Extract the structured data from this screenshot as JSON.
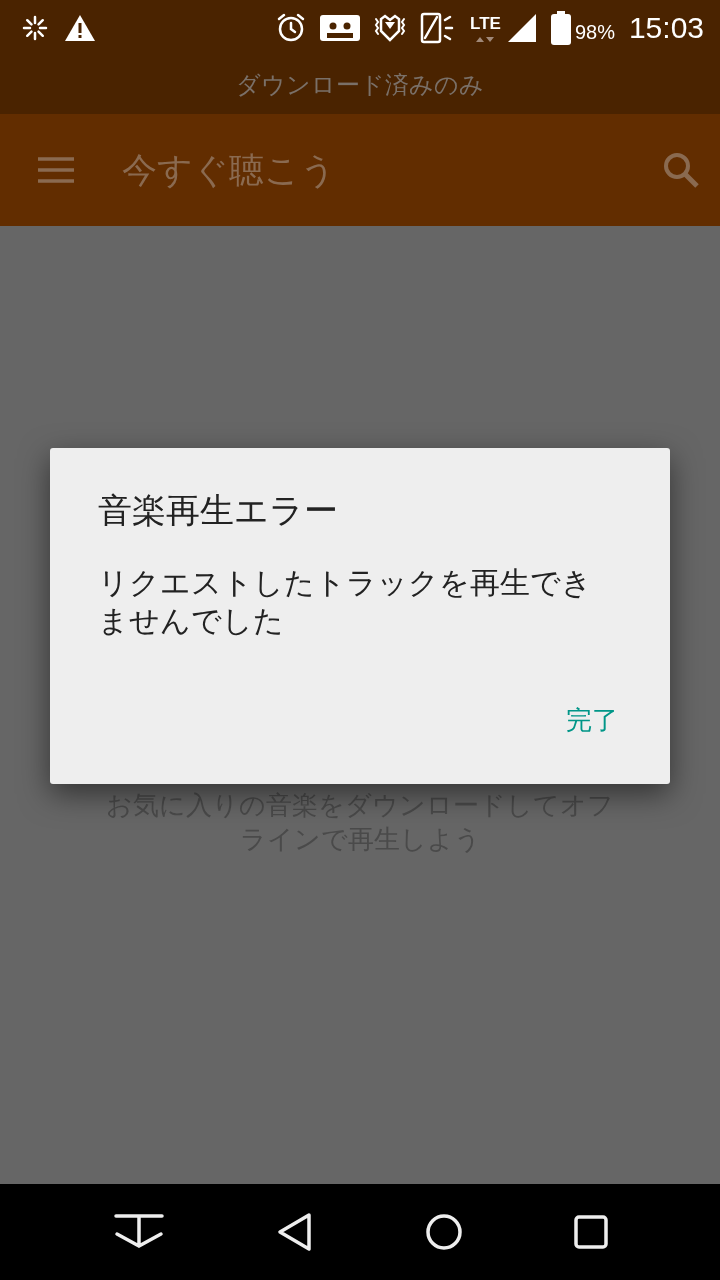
{
  "status_bar": {
    "network": "LTE",
    "battery": "98%",
    "time": "15:03"
  },
  "offline_banner": "ダウンロード済みのみ",
  "app_bar": {
    "title": "今すぐ聴こう"
  },
  "empty_state": "お気に入りの音楽をダウンロードしてオフラインで再生しよう",
  "dialog": {
    "title": "音楽再生エラー",
    "message": "リクエストしたトラックを再生できませんでした",
    "buttons": [
      "完了"
    ]
  }
}
